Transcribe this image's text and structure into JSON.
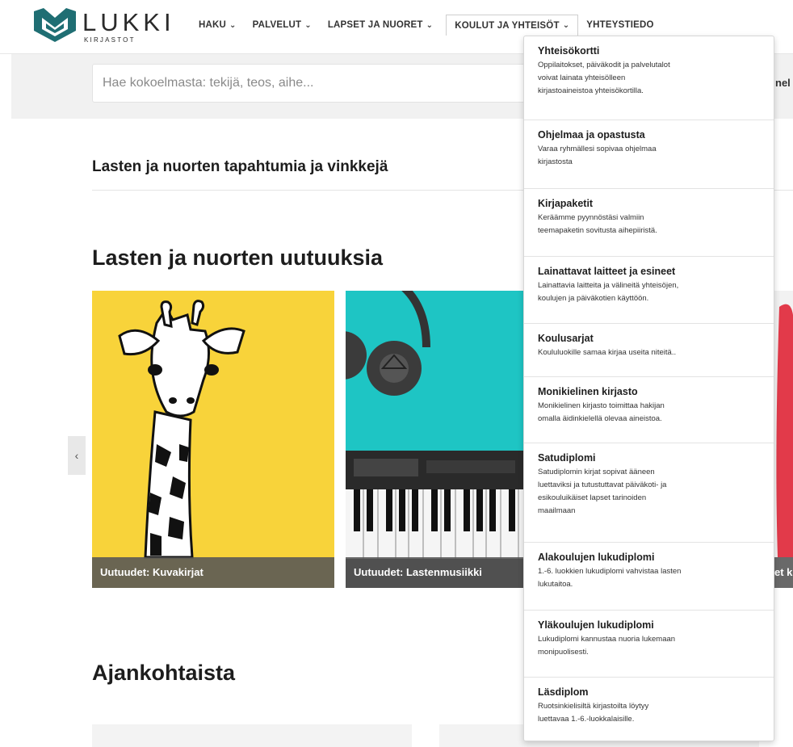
{
  "logo": {
    "name": "LUKKI",
    "subtitle": "KIRJASTOT"
  },
  "nav": {
    "items": [
      {
        "label": "HAKU",
        "chevron": "chevron-down-icon"
      },
      {
        "label": "PALVELUT",
        "chevron": "chevron-down-icon"
      },
      {
        "label": "LAPSET JA NUORET",
        "chevron": "chevron-down-icon"
      },
      {
        "label": "KOULUT JA YHTEISÖT",
        "chevron": "chevron-down-icon",
        "active": true
      },
      {
        "label": "YHTEYSTIEDO",
        "chevron": ""
      }
    ]
  },
  "search": {
    "placeholder": "Hae kokoelmasta: tekijä, teos, aihe...",
    "side_text": "nel"
  },
  "sections": {
    "events_title": "Lasten ja nuorten tapahtumia ja vinkkejä",
    "news_title": "Lasten ja nuorten uutuuksia",
    "current_title": "Ajankohtaista"
  },
  "carousel": {
    "prev_icon": "chevron-left-icon",
    "prev_symbol": "‹",
    "cards": [
      {
        "caption": "Uutuudet: Kuvakirjat",
        "image": "giraffe-illustration"
      },
      {
        "caption": "Uutuudet: Lastenmusiikki",
        "image": "headphones-keyboard-photo"
      },
      {
        "caption": "et ki",
        "image": "red-object-photo"
      }
    ]
  },
  "dropdown": {
    "items": [
      {
        "title": "Yhteisökortti",
        "desc": [
          "Oppilaitokset, päiväkodit ja palvelutalot",
          "voivat lainata yhteisölleen",
          "kirjastoaineistoa yhteisökortilla."
        ]
      },
      {
        "title": "Ohjelmaa ja opastusta",
        "desc": [
          "Varaa ryhmällesi sopivaa ohjelmaa",
          "kirjastosta"
        ]
      },
      {
        "title": "Kirjapaketit",
        "desc": [
          "Keräämme pyynnöstäsi valmiin",
          "teemapaketin sovitusta aihepiiristä."
        ]
      },
      {
        "title": "Lainattavat laitteet ja esineet",
        "desc": [
          "Lainattavia laitteita ja välineitä yhteisöjen,",
          "koulujen ja päiväkotien käyttöön."
        ]
      },
      {
        "title": "Koulusarjat",
        "desc": [
          "Koululuokille samaa kirjaa useita niteitä.."
        ]
      },
      {
        "title": "Monikielinen kirjasto",
        "desc": [
          "Monikielinen kirjasto toimittaa hakijan",
          "omalla äidinkielellä olevaa aineistoa."
        ]
      },
      {
        "title": "Satudiplomi",
        "desc": [
          "Satudiplomin kirjat sopivat ääneen",
          "luettaviksi ja tutustuttavat päiväkoti- ja",
          "esikouluikäiset lapset tarinoiden",
          "maailmaan"
        ]
      },
      {
        "title": "Alakoulujen lukudiplomi",
        "desc": [
          "1.-6. luokkien lukudiplomi vahvistaa lasten",
          "lukutaitoa."
        ]
      },
      {
        "title": "Yläkoulujen lukudiplomi",
        "desc": [
          "Lukudiplomi kannustaa nuoria lukemaan",
          "monipuolisesti."
        ]
      },
      {
        "title": "Läsdiplom",
        "desc": [
          "Ruotsinkielisiltä kirjastoilta löytyy",
          "luettavaa 1.-6.-luokkalaisille."
        ]
      }
    ]
  },
  "colors": {
    "brand": "#1f6e73",
    "caption_bg": "#555555",
    "yellow": "#f8d33a",
    "teal": "#1ec5c4"
  }
}
